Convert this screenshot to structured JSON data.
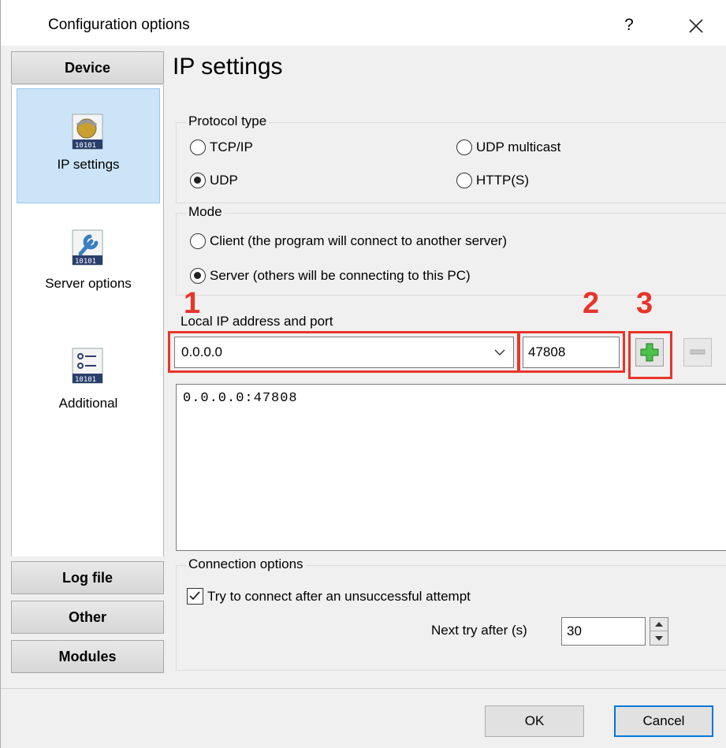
{
  "window": {
    "title": "Configuration options",
    "help_glyph": "?",
    "close_glyph": "✕"
  },
  "sidebar": {
    "header": "Device",
    "items": [
      {
        "label": "IP settings",
        "icon": "network-icon",
        "selected": true
      },
      {
        "label": "Server options",
        "icon": "wrench-icon",
        "selected": false
      },
      {
        "label": "Additional",
        "icon": "list-settings-icon",
        "selected": false
      }
    ],
    "sections": [
      "Log file",
      "Other",
      "Modules"
    ]
  },
  "page": {
    "title": "IP settings"
  },
  "protocol": {
    "label": "Protocol type",
    "options": [
      {
        "label": "TCP/IP",
        "checked": false
      },
      {
        "label": "UDP multicast",
        "checked": false
      },
      {
        "label": "UDP",
        "checked": true
      },
      {
        "label": "HTTP(S)",
        "checked": false
      }
    ]
  },
  "mode": {
    "label": "Mode",
    "options": [
      {
        "label": "Client (the program will connect to another server)",
        "checked": false
      },
      {
        "label": "Server (others will be connecting to this PC)",
        "checked": true
      }
    ]
  },
  "address": {
    "label": "Local IP address and port",
    "ip_value": "0.0.0.0",
    "port_value": "47808",
    "list": [
      "0.0.0.0:47808"
    ]
  },
  "annotations": [
    "1",
    "2",
    "3"
  ],
  "connection": {
    "label": "Connection options",
    "retry_label": "Try to connect after an unsuccessful attempt",
    "retry_checked": true,
    "next_try_label": "Next try after (s)",
    "next_try_value": "30"
  },
  "footer": {
    "ok_label": "OK",
    "cancel_label": "Cancel"
  },
  "colors": {
    "highlight": "#e8352a",
    "selected_bg": "#cce4f7",
    "accent": "#0078d7"
  }
}
